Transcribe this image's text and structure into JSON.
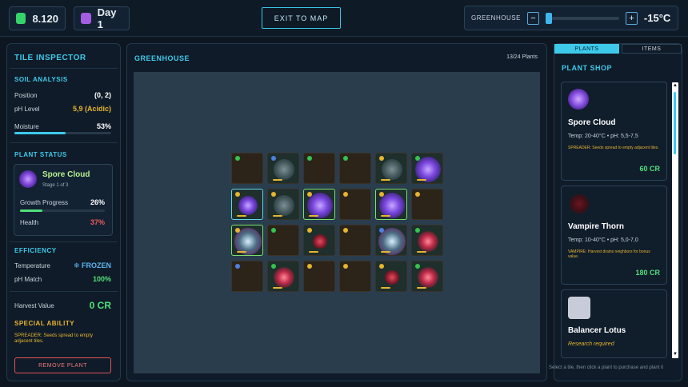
{
  "top": {
    "credits": "8.120",
    "day": "Day 1",
    "exit_label": "EXIT TO MAP",
    "temp_label": "GREENHOUSE",
    "minus": "−",
    "plus": "+",
    "temperature": "-15°C",
    "slider_fraction": 0.0
  },
  "inspector": {
    "title": "TILE INSPECTOR",
    "soil_title": "SOIL ANALYSIS",
    "position_label": "Position",
    "position_value": "(0, 2)",
    "ph_label": "pH Level",
    "ph_value": "5,9 (Acidic)",
    "moisture_label": "Moisture",
    "moisture_value": "53%",
    "moisture_fraction": 0.53,
    "plant_status_title": "PLANT STATUS",
    "plant_name": "Spore Cloud",
    "plant_stage": "Stage 1 of 3",
    "growth_label": "Growth Progress",
    "growth_value": "26%",
    "growth_fraction": 0.26,
    "health_label": "Health",
    "health_value": "37%",
    "efficiency_title": "EFFICIENCY",
    "temperature_label": "Temperature",
    "temperature_value": "❄ FROZEN",
    "phmatch_label": "pH Match",
    "phmatch_value": "100%",
    "harvest_label": "Harvest Value",
    "harvest_value": "0 CR",
    "special_title": "SPECIAL ABILITY",
    "special_text": "SPREADER: Seeds spread to empty adjacent tiles.",
    "remove_label": "REMOVE PLANT"
  },
  "greenhouse": {
    "title": "GREENHOUSE",
    "count": "13/24 Plants",
    "tiles": [
      {
        "dot": "#36c24e",
        "plant": "none",
        "border": "none"
      },
      {
        "dot": "#4f7fe0",
        "plant": "sprout",
        "border": "none"
      },
      {
        "dot": "#36c24e",
        "plant": "none",
        "border": "none"
      },
      {
        "dot": "#36c24e",
        "plant": "none",
        "border": "none"
      },
      {
        "dot": "#e6b530",
        "plant": "sprout",
        "border": "none"
      },
      {
        "dot": "#36c24e",
        "plant": "rose",
        "border": "none"
      },
      {
        "dot": "#e6b530",
        "plant": "rose-small",
        "border": "teal"
      },
      {
        "dot": "#e6b530",
        "plant": "sprout",
        "border": "none"
      },
      {
        "dot": "#e6b530",
        "plant": "rose",
        "border": "green"
      },
      {
        "dot": "#e6b530",
        "plant": "none",
        "border": "none"
      },
      {
        "dot": "#e6b530",
        "plant": "rose",
        "border": "green"
      },
      {
        "dot": "#e6b530",
        "plant": "none",
        "border": "none"
      },
      {
        "dot": "#e6b530",
        "plant": "spore",
        "border": "green"
      },
      {
        "dot": "#36c24e",
        "plant": "none",
        "border": "none"
      },
      {
        "dot": "#e6b530",
        "plant": "thorn-small",
        "border": "none"
      },
      {
        "dot": "#e6b530",
        "plant": "none",
        "border": "none"
      },
      {
        "dot": "#4f7fe0",
        "plant": "spore",
        "border": "none"
      },
      {
        "dot": "#36c24e",
        "plant": "thorn",
        "border": "none"
      },
      {
        "dot": "#4f7fe0",
        "plant": "none",
        "border": "none"
      },
      {
        "dot": "#36c24e",
        "plant": "thorn",
        "border": "none"
      },
      {
        "dot": "#e6b530",
        "plant": "none",
        "border": "none"
      },
      {
        "dot": "#e6b530",
        "plant": "none",
        "border": "none"
      },
      {
        "dot": "#e6b530",
        "plant": "thorn-small",
        "border": "none"
      },
      {
        "dot": "#36c24e",
        "plant": "thorn",
        "border": "none"
      }
    ]
  },
  "shop": {
    "tab_plants": "PLANTS",
    "tab_items": "ITEMS",
    "title": "PLANT SHOP",
    "cards": [
      {
        "name": "Spore Cloud",
        "stats": "Temp: 20-40°C  •  pH: 5,5-7,5",
        "ability": "SPREADER: Seeds spread to empty adjacent tiles.",
        "price": "60 CR"
      },
      {
        "name": "Vampire Thorn",
        "stats": "Temp: 10-40°C  •  pH: 5,0-7,0",
        "ability": "VAMPIRE: Harvest drains neighbors for bonus value.",
        "price": "180 CR"
      },
      {
        "name": "Balancer Lotus",
        "research": "Research required"
      }
    ],
    "hint": "Select a tile, then click a plant to purchase and plant it",
    "scroll_up": "▲",
    "scroll_down": "▼"
  }
}
